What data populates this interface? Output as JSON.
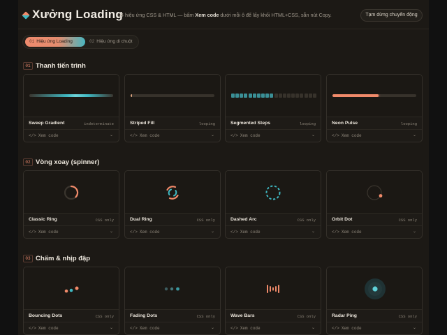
{
  "header": {
    "title": "Xưởng Loading",
    "subtitle_pre": "24 hiệu ứng CSS & HTML — bấm ",
    "subtitle_bold": "Xem code",
    "subtitle_post": " dưới mỗi ô để lấy khối HTML+CSS, sẵn nút Copy.",
    "pause_label": "Tạm dừng chuyển động"
  },
  "tabs": [
    {
      "num": "01",
      "label": "Hiệu ứng Loading",
      "active": true
    },
    {
      "num": "02",
      "label": "Hiệu ứng di chuột",
      "active": false
    }
  ],
  "sections": [
    {
      "num": "01",
      "title": "Thanh tiến trình",
      "cards": [
        {
          "name": "Sweep Gradient",
          "tag": "indeterminate",
          "code_label": "Xem code",
          "preview": "sweep"
        },
        {
          "name": "Striped Fill",
          "tag": "looping",
          "code_label": "Xem code",
          "preview": "striped",
          "progress": 0.02
        },
        {
          "name": "Segmented Steps",
          "tag": "looping",
          "code_label": "Xem code",
          "preview": "segments",
          "segments_total": 20,
          "segments_filled": 10
        },
        {
          "name": "Neon Pulse",
          "tag": "looping",
          "code_label": "Xem code",
          "preview": "neon",
          "progress": 0.55
        }
      ]
    },
    {
      "num": "02",
      "title": "Vòng xoay (spinner)",
      "cards": [
        {
          "name": "Classic Ring",
          "tag": "CSS only",
          "code_label": "Xem code",
          "preview": "classic-ring"
        },
        {
          "name": "Dual Ring",
          "tag": "CSS only",
          "code_label": "Xem code",
          "preview": "dual-ring"
        },
        {
          "name": "Dashed Arc",
          "tag": "CSS only",
          "code_label": "Xem code",
          "preview": "dashed-arc"
        },
        {
          "name": "Orbit Dot",
          "tag": "CSS only",
          "code_label": "Xem code",
          "preview": "orbit-dot"
        }
      ]
    },
    {
      "num": "03",
      "title": "Chấm & nhịp đập",
      "cards": [
        {
          "name": "Bouncing Dots",
          "tag": "CSS only",
          "code_label": "Xem code",
          "preview": "bouncing-dots"
        },
        {
          "name": "Fading Dots",
          "tag": "CSS only",
          "code_label": "Xem code",
          "preview": "fading-dots"
        },
        {
          "name": "Wave Bars",
          "tag": "CSS only",
          "code_label": "Xem code",
          "preview": "wave-bars"
        },
        {
          "name": "Radar Ping",
          "tag": "CSS only",
          "code_label": "Xem code",
          "preview": "radar-ping"
        }
      ]
    }
  ],
  "colors": {
    "accent_coral": "#f08a6a",
    "accent_teal": "#3fb8c2",
    "background": "#1c1915",
    "card": "#1e1b17"
  },
  "icons": {
    "logo": "diamond-logo-icon",
    "code": "code-brackets-icon",
    "expand": "chevron-down-icon"
  }
}
